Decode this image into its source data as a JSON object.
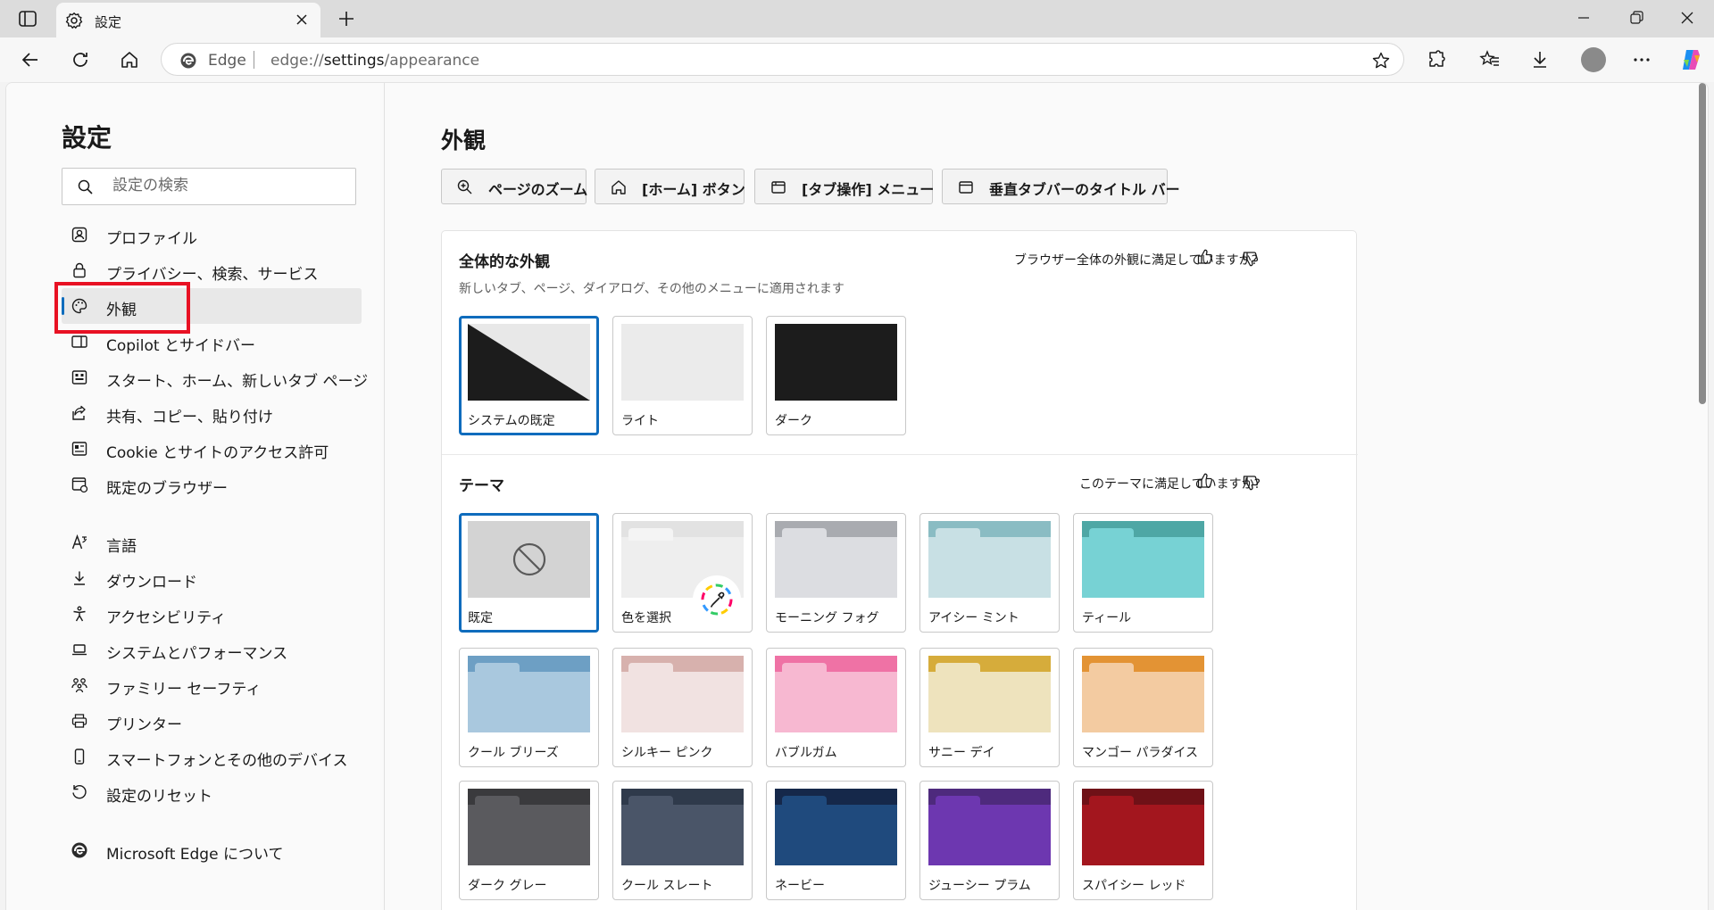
{
  "browser": {
    "tab_title": "設定",
    "omnibox_brand": "Edge",
    "url_prefix": "edge://",
    "url_bold": "settings",
    "url_suffix": "/appearance"
  },
  "sidebar": {
    "title": "設定",
    "search_placeholder": "設定の検索",
    "items": [
      {
        "label": "プロファイル",
        "icon": "profile-icon"
      },
      {
        "label": "プライバシー、検索、サービス",
        "icon": "lock-icon"
      },
      {
        "label": "外観",
        "icon": "palette-icon",
        "active": true
      },
      {
        "label": "Copilot とサイドバー",
        "icon": "sidebar-icon"
      },
      {
        "label": "スタート、ホーム、新しいタブ ページ",
        "icon": "home-grid-icon"
      },
      {
        "label": "共有、コピー、貼り付け",
        "icon": "share-icon"
      },
      {
        "label": "Cookie とサイトのアクセス許可",
        "icon": "site-permissions-icon"
      },
      {
        "label": "既定のブラウザー",
        "icon": "default-browser-icon"
      },
      {
        "label": "言語",
        "icon": "language-icon"
      },
      {
        "label": "ダウンロード",
        "icon": "download-icon"
      },
      {
        "label": "アクセシビリティ",
        "icon": "accessibility-icon"
      },
      {
        "label": "システムとパフォーマンス",
        "icon": "laptop-icon"
      },
      {
        "label": "ファミリー セーフティ",
        "icon": "family-icon"
      },
      {
        "label": "プリンター",
        "icon": "printer-icon"
      },
      {
        "label": "スマートフォンとその他のデバイス",
        "icon": "phone-icon"
      },
      {
        "label": "設定のリセット",
        "icon": "reset-icon"
      },
      {
        "label": "Microsoft Edge について",
        "icon": "edge-icon"
      }
    ]
  },
  "main": {
    "title": "外観",
    "chips": [
      {
        "label": "ページのズーム",
        "icon": "zoom-icon"
      },
      {
        "label": "[ホーム] ボタン",
        "icon": "home-icon"
      },
      {
        "label": "[タブ操作] メニュー",
        "icon": "tab-menu-icon"
      },
      {
        "label": "垂直タブバーのタイトル バー",
        "icon": "window-icon"
      }
    ],
    "overall": {
      "title": "全体的な外観",
      "subtitle": "新しいタブ、ページ、ダイアログ、その他のメニューに適用されます",
      "feedback": "ブラウザー全体の外観に満足していますか?",
      "options": [
        {
          "label": "システムの既定",
          "selected": true
        },
        {
          "label": "ライト"
        },
        {
          "label": "ダーク"
        }
      ]
    },
    "theme": {
      "title": "テーマ",
      "feedback": "このテーマに満足していますか?",
      "items": [
        {
          "label": "既定",
          "selected": true
        },
        {
          "label": "色を選択"
        },
        {
          "label": "モーニング フォグ",
          "top": "#a9abb0",
          "body": "#dcdde1"
        },
        {
          "label": "アイシー ミント",
          "top": "#8abcc3",
          "body": "#c8e0e4"
        },
        {
          "label": "ティール",
          "top": "#4ea7a5",
          "body": "#77d2d4"
        },
        {
          "label": "クール ブリーズ",
          "top": "#6d9fc4",
          "body": "#a9c8de"
        },
        {
          "label": "シルキー ピンク",
          "top": "#d7b1ad",
          "body": "#f1e2e1"
        },
        {
          "label": "バブルガム",
          "top": "#ef72a5",
          "body": "#f7b8d1"
        },
        {
          "label": "サニー デイ",
          "top": "#d6ac3b",
          "body": "#eee3bd"
        },
        {
          "label": "マンゴー パラダイス",
          "top": "#e39334",
          "body": "#f3cba1"
        },
        {
          "label": "ダーク グレー",
          "top": "#3a3a3d",
          "body": "#5a5a5e"
        },
        {
          "label": "クール スレート",
          "top": "#2f3a4b",
          "body": "#4a5568"
        },
        {
          "label": "ネービー",
          "top": "#15284a",
          "body": "#1f4a7d"
        },
        {
          "label": "ジューシー プラム",
          "top": "#4e2a7d",
          "body": "#6d37b0"
        },
        {
          "label": "スパイシー レッド",
          "top": "#6f1117",
          "body": "#a3161e"
        }
      ]
    }
  }
}
